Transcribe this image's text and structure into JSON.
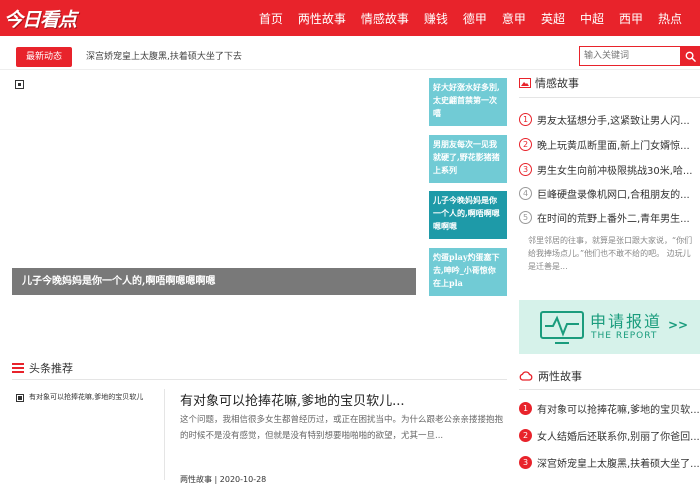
{
  "header": {
    "logo": "今日看点",
    "nav": [
      "首页",
      "两性故事",
      "情感故事",
      "赚钱",
      "德甲",
      "意甲",
      "英超",
      "中超",
      "西甲",
      "热点"
    ]
  },
  "newsbar": {
    "tag": "最新动态",
    "text": "深宫娇宠皇上太腹黑,扶着硕大坐了下去",
    "search_placeholder": "输入关键词"
  },
  "hero": {
    "caption": "儿子今晚妈妈是你一个人的,啊唔啊嗯嗯啊嗯"
  },
  "thumbs": [
    "好大好涨水好多別,太史翩首禁第一次嘻",
    "男朋友每次一见我就硬了,野花影猪猪上系列",
    "儿子今晚妈妈是你一个人的,啊唔啊嗯嗯啊嗯",
    "灼蛋play灼蛋塞下去,呻吟_小哥惊你在上pla"
  ],
  "sidebar_emotion": {
    "title": "情感故事",
    "items": [
      {
        "num": "1",
        "text": "男友太猛想分手,这紧致让男人闪..."
      },
      {
        "num": "2",
        "text": "晚上玩黄瓜断里面,新上门女婿惊..."
      },
      {
        "num": "3",
        "text": "男生女生向前冲极限挑战30米,哈..."
      },
      {
        "num": "4",
        "text": "巨峰硬盘录像机网口,合租朋友的..."
      },
      {
        "num": "5",
        "text": "在时间的荒野上番外二,青年男生..."
      }
    ],
    "desc": "邻里邻居的往事，就算是张口跟大家说，“你们给我捧场点儿。”他们也不敢不给的吧。 边玩儿是迁善是..."
  },
  "report": {
    "cn": "申请报道",
    "en": "THE REPORT",
    "arrow": ">>",
    "color": "#1a9c7d"
  },
  "headline": {
    "title": "头条推荐",
    "small_link": "有对象可以抢捧花嘛,爹地的宝贝软儿",
    "article_title": "有对象可以抢捧花嘛,爹地的宝贝软儿...",
    "article_desc": "这个问题，我相信很多女生都曾经历过，或正在困扰当中。为什么跟老公亲亲搂搂抱抱的时候不是没有感觉，但就是没有特别想要啪啪啪的欲望，尤其一旦...",
    "meta": "两性故事  |  2020-10-28"
  },
  "sidebar_sex": {
    "title": "两性故事",
    "items": [
      {
        "num": "1",
        "text": "有对象可以抢捧花嘛,爹地的宝贝软..."
      },
      {
        "num": "2",
        "text": "女人结婚后还联系你,别丽了你爸回..."
      },
      {
        "num": "3",
        "text": "深宫娇宠皇上太腹黑,扶着硕大坐了..."
      }
    ]
  },
  "colors": {
    "brand": "#e8232b",
    "thumb": "#71cbd5",
    "thumb_active": "#1e9aa8"
  }
}
